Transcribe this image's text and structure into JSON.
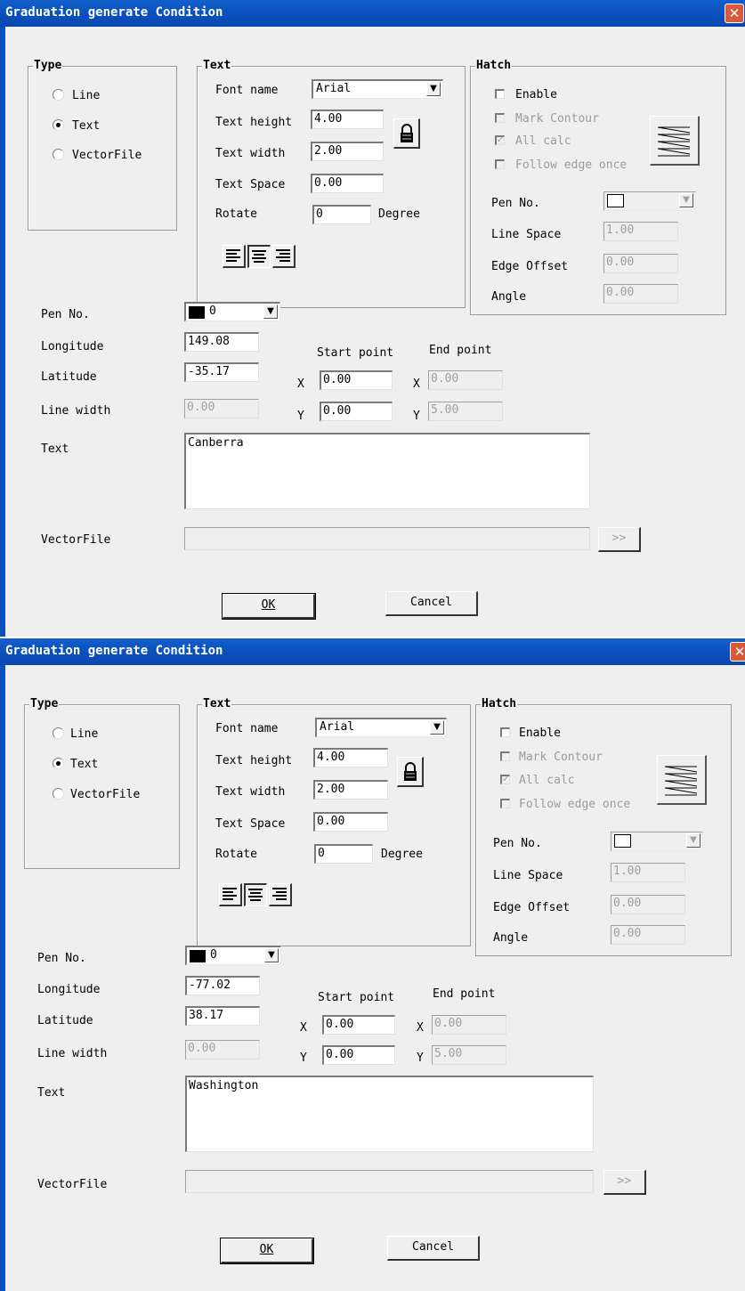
{
  "dialogs": [
    {
      "title": "Graduation generate Condition",
      "close_glyph": "✕",
      "type_group": {
        "title": "Type",
        "options": [
          "Line",
          "Text",
          "VectorFile"
        ],
        "selected": "Text"
      },
      "text_group": {
        "title": "Text",
        "font_name_label": "Font name",
        "font_name_value": "Arial",
        "text_height_label": "Text height",
        "text_height_value": "4.00",
        "text_width_label": "Text width",
        "text_width_value": "2.00",
        "text_space_label": "Text Space",
        "text_space_value": "0.00",
        "rotate_label": "Rotate",
        "rotate_value": "0",
        "rotate_unit": "Degree",
        "lock_icon": "lock-icon",
        "alignment_selected": "center"
      },
      "hatch_group": {
        "title": "Hatch",
        "enable_label": "Enable",
        "enable_checked": false,
        "mark_contour_label": "Mark Contour",
        "mark_contour_checked": false,
        "all_calc_label": "All calc",
        "all_calc_checked": true,
        "follow_edge_label": "Follow edge once",
        "follow_edge_checked": false,
        "pen_no_label": "Pen No.",
        "line_space_label": "Line Space",
        "line_space_value": "1.00",
        "edge_offset_label": "Edge Offset",
        "edge_offset_value": "0.00",
        "angle_label": "Angle",
        "angle_value": "0.00"
      },
      "pen_no_label": "Pen No.",
      "pen_no_value": "0",
      "longitude_label": "Longitude",
      "longitude_value": "149.08",
      "latitude_label": "Latitude",
      "latitude_value": "-35.17",
      "line_width_label": "Line width",
      "line_width_value": "0.00",
      "start_point_label": "Start point",
      "end_point_label": "End point",
      "x_label": "X",
      "y_label": "Y",
      "start_x": "0.00",
      "start_y": "0.00",
      "end_x": "0.00",
      "end_y": "5.00",
      "text_label": "Text",
      "text_value": "Canberra",
      "vectorfile_label": "VectorFile",
      "vectorfile_value": "",
      "browse_label": ">>",
      "ok_label": "OK",
      "cancel_label": "Cancel"
    },
    {
      "title": "Graduation generate Condition",
      "close_glyph": "✕",
      "type_group": {
        "title": "Type",
        "options": [
          "Line",
          "Text",
          "VectorFile"
        ],
        "selected": "Text"
      },
      "text_group": {
        "title": "Text",
        "font_name_label": "Font name",
        "font_name_value": "Arial",
        "text_height_label": "Text height",
        "text_height_value": "4.00",
        "text_width_label": "Text width",
        "text_width_value": "2.00",
        "text_space_label": "Text Space",
        "text_space_value": "0.00",
        "rotate_label": "Rotate",
        "rotate_value": "0",
        "rotate_unit": "Degree",
        "lock_icon": "lock-icon",
        "alignment_selected": "center"
      },
      "hatch_group": {
        "title": "Hatch",
        "enable_label": "Enable",
        "enable_checked": false,
        "mark_contour_label": "Mark Contour",
        "mark_contour_checked": false,
        "all_calc_label": "All calc",
        "all_calc_checked": true,
        "follow_edge_label": "Follow edge once",
        "follow_edge_checked": false,
        "pen_no_label": "Pen No.",
        "line_space_label": "Line Space",
        "line_space_value": "1.00",
        "edge_offset_label": "Edge Offset",
        "edge_offset_value": "0.00",
        "angle_label": "Angle",
        "angle_value": "0.00"
      },
      "pen_no_label": "Pen No.",
      "pen_no_value": "0",
      "longitude_label": "Longitude",
      "longitude_value": "-77.02",
      "latitude_label": "Latitude",
      "latitude_value": "38.17",
      "line_width_label": "Line width",
      "line_width_value": "0.00",
      "start_point_label": "Start point",
      "end_point_label": "End point",
      "x_label": "X",
      "y_label": "Y",
      "start_x": "0.00",
      "start_y": "0.00",
      "end_x": "0.00",
      "end_y": "5.00",
      "text_label": "Text",
      "text_value": "Washington",
      "vectorfile_label": "VectorFile",
      "vectorfile_value": "",
      "browse_label": ">>",
      "ok_label": "OK",
      "cancel_label": "Cancel"
    }
  ]
}
